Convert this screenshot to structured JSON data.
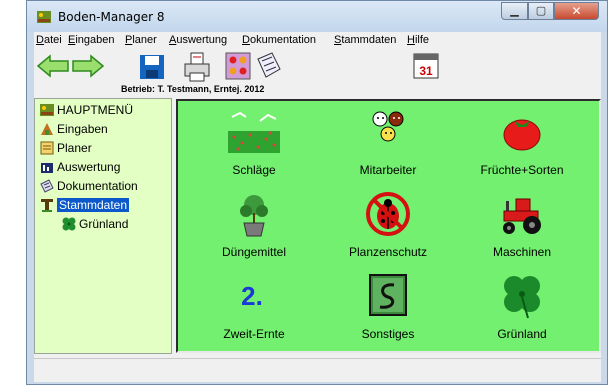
{
  "window": {
    "title": "Boden-Manager 8"
  },
  "menu": [
    "Datei",
    "Eingaben",
    "Planer",
    "Auswertung",
    "Dokumentation",
    "Stammdaten",
    "Hilfe"
  ],
  "toolbar": {
    "betrieb": "Betrieb: T. Testmann, Erntej. 2012"
  },
  "tree": [
    {
      "label": "HAUPTMENÜ",
      "icon": "main-menu-icon"
    },
    {
      "label": "Eingaben",
      "icon": "eingaben-icon"
    },
    {
      "label": "Planer",
      "icon": "planer-icon"
    },
    {
      "label": "Auswertung",
      "icon": "auswertung-icon"
    },
    {
      "label": "Dokumentation",
      "icon": "dokumentation-icon"
    },
    {
      "label": "Stammdaten",
      "icon": "stammdaten-icon",
      "selected": true
    },
    {
      "label": "Grünland",
      "icon": "clover-icon"
    }
  ],
  "grid": [
    {
      "label": "Schläge",
      "icon": "field-icon"
    },
    {
      "label": "Mitarbeiter",
      "icon": "people-icon"
    },
    {
      "label": "Früchte+Sorten",
      "icon": "tomato-icon"
    },
    {
      "label": "Düngemittel",
      "icon": "plant-pot-icon"
    },
    {
      "label": "Planzenschutz",
      "icon": "ladybug-prohibited-icon"
    },
    {
      "label": "Maschinen",
      "icon": "tractor-icon"
    },
    {
      "label": "Zweit-Ernte",
      "icon": "number-two-icon"
    },
    {
      "label": "Sonstiges",
      "icon": "misc-icon"
    },
    {
      "label": "Grünland",
      "icon": "clover-icon"
    }
  ]
}
